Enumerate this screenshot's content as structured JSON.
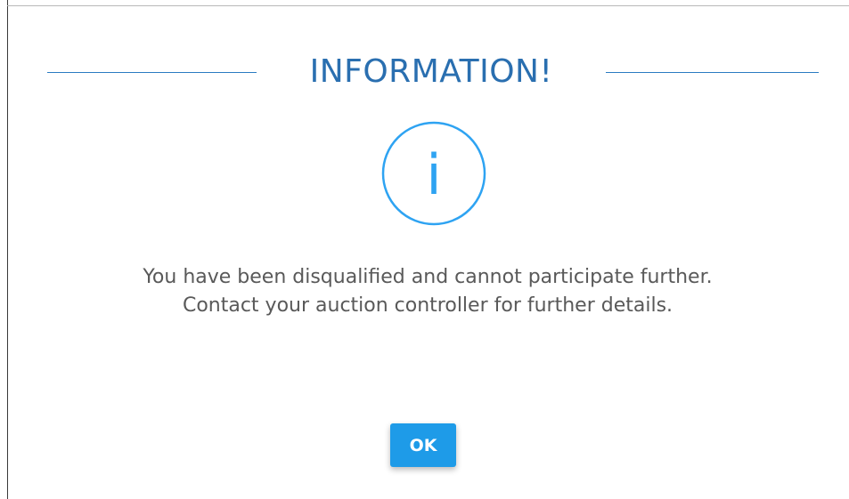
{
  "dialog": {
    "title": "INFORMATION!",
    "icon": "info-icon",
    "icon_glyph": "i",
    "message_lines": [
      "You have been disqualified and cannot participate further.",
      "Contact your auction controller for further details."
    ],
    "ok_label": "OK"
  },
  "colors": {
    "title": "#2a6fb0",
    "accent": "#2b7bc1",
    "icon_stroke": "#2ea3f2",
    "message_text": "#595959",
    "button_bg": "#1e9be8",
    "button_text": "#ffffff"
  }
}
